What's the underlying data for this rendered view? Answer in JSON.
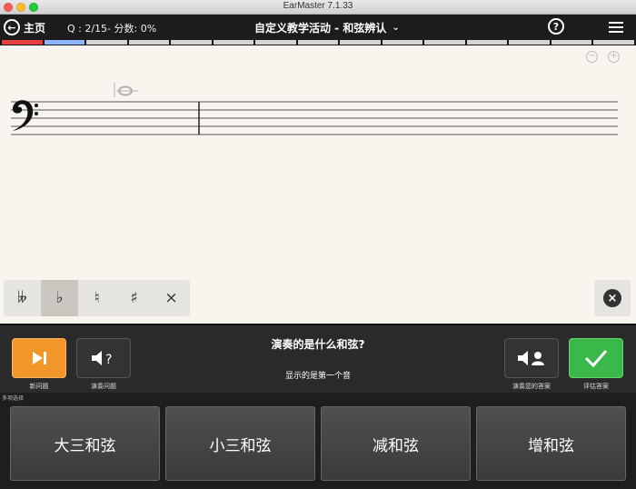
{
  "window": {
    "title": "EarMaster 7.1.33"
  },
  "nav": {
    "home_label": "主页",
    "progress": "Q : 2/15- 分数: 0%",
    "activity_title": "自定义教学活动 - 和弦辨认",
    "question_index": 2,
    "question_total": 15
  },
  "accidentals": [
    {
      "icon": "double-flat-icon",
      "glyph": "𝄫"
    },
    {
      "icon": "flat-icon",
      "glyph": "♭",
      "selected": true
    },
    {
      "icon": "natural-icon",
      "glyph": "♮"
    },
    {
      "icon": "sharp-icon",
      "glyph": "♯"
    },
    {
      "icon": "double-sharp-icon",
      "glyph": "×"
    }
  ],
  "controls": {
    "new_question": "新问题",
    "play_question": "演奏问题",
    "play_answer": "演奏您的答案",
    "evaluate": "评估答案",
    "question_text": "演奏的是什么和弦?",
    "hint_text": "显示的是第一个音"
  },
  "answers": {
    "section_label": "多项选择",
    "options": [
      "大三和弦",
      "小三和弦",
      "减和弦",
      "增和弦"
    ]
  },
  "colors": {
    "new_question_button": "#f2962a",
    "evaluate_button": "#3bb84a",
    "progress_done": "#e84040",
    "progress_current": "#8cb4ff"
  }
}
